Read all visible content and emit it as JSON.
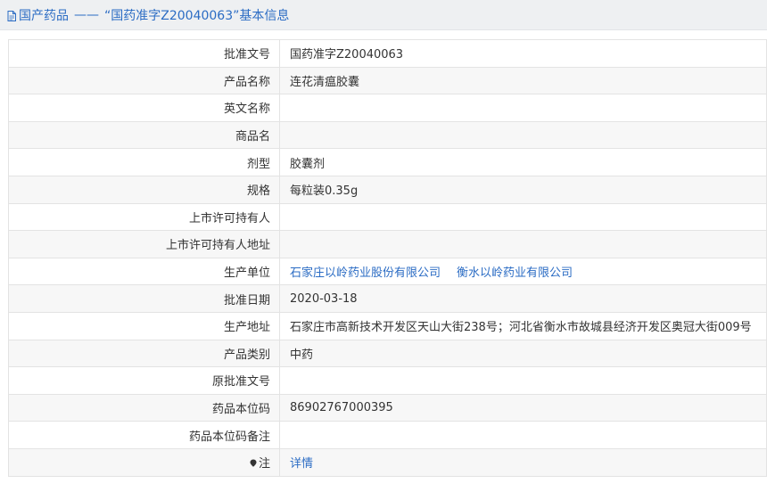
{
  "header": {
    "category": "国产药品",
    "separator": "——",
    "title": "“国药准字Z20040063”基本信息"
  },
  "rows": [
    {
      "label": "批准文号",
      "value": "国药准字Z20040063"
    },
    {
      "label": "产品名称",
      "value": "连花清瘟胶囊"
    },
    {
      "label": "英文名称",
      "value": ""
    },
    {
      "label": "商品名",
      "value": ""
    },
    {
      "label": "剂型",
      "value": "胶囊剂"
    },
    {
      "label": "规格",
      "value": "每粒装0.35g"
    },
    {
      "label": "上市许可持有人",
      "value": ""
    },
    {
      "label": "上市许可持有人地址",
      "value": ""
    },
    {
      "label": "生产单位",
      "links": [
        "石家庄以岭药业股份有限公司",
        "衡水以岭药业有限公司"
      ]
    },
    {
      "label": "批准日期",
      "value": "2020-03-18"
    },
    {
      "label": "生产地址",
      "value": "石家庄市高新技术开发区天山大街238号；河北省衡水市故城县经济开发区奥冠大街009号"
    },
    {
      "label": "产品类别",
      "value": "中药"
    },
    {
      "label": "原批准文号",
      "value": ""
    },
    {
      "label": "药品本位码",
      "value": "86902767000395"
    },
    {
      "label": "药品本位码备注",
      "value": ""
    },
    {
      "label": "注",
      "link": "详情",
      "icon": "map-pin-icon"
    }
  ],
  "colors": {
    "link": "#2b6cc4",
    "header_bg": "#eef0f2",
    "stripe": "#f7f7f7",
    "border": "#e3e3e3"
  }
}
